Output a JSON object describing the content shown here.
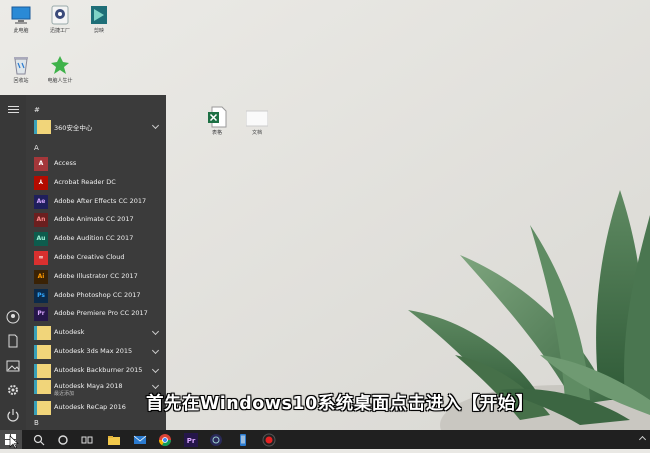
{
  "desktop": {
    "icons": [
      {
        "label": "此电脑",
        "icon": "computer-icon"
      },
      {
        "label": "迅捷工厂",
        "icon": "app-icon"
      },
      {
        "label": "剪映",
        "icon": "video-editor-icon"
      },
      {
        "label": "回收站",
        "icon": "recycle-bin-icon"
      },
      {
        "label": "电脑人生计",
        "icon": "app-icon"
      },
      {
        "label": "表格",
        "icon": "excel-file-icon"
      },
      {
        "label": "文档",
        "icon": "blank-file-icon"
      }
    ]
  },
  "start_menu": {
    "sections": [
      {
        "letter": "#"
      },
      {
        "letter": "A"
      }
    ],
    "items": [
      {
        "label": "360安全中心",
        "icon": "folder-icon",
        "expandable": true
      },
      {
        "label": "Access",
        "icon": "access-icon",
        "color": "#a4373a"
      },
      {
        "label": "Acrobat Reader DC",
        "icon": "acrobat-icon",
        "color": "#b30b00"
      },
      {
        "label": "Adobe After Effects CC 2017",
        "icon": "after-effects-icon",
        "tile": "Ae",
        "color": "#1f1f5c"
      },
      {
        "label": "Adobe Animate CC 2017",
        "icon": "animate-icon",
        "tile": "An",
        "color": "#6b1f1f"
      },
      {
        "label": "Adobe Audition CC 2017",
        "icon": "audition-icon",
        "tile": "Au",
        "color": "#0d5c4d"
      },
      {
        "label": "Adobe Creative Cloud",
        "icon": "creative-cloud-icon",
        "color": "#d9302f"
      },
      {
        "label": "Adobe Illustrator CC 2017",
        "icon": "illustrator-icon",
        "tile": "Ai",
        "color": "#3a2205"
      },
      {
        "label": "Adobe Photoshop CC 2017",
        "icon": "photoshop-icon",
        "tile": "Ps",
        "color": "#0b2a4a"
      },
      {
        "label": "Adobe Premiere Pro CC 2017",
        "icon": "premiere-icon",
        "tile": "Pr",
        "color": "#25164a"
      },
      {
        "label": "Autodesk",
        "icon": "folder-icon",
        "expandable": true
      },
      {
        "label": "Autodesk 3ds Max 2015",
        "icon": "folder-icon",
        "expandable": true
      },
      {
        "label": "Autodesk Backburner 2015",
        "icon": "folder-icon",
        "expandable": true
      },
      {
        "label": "Autodesk Maya 2018",
        "sub": "最近添加",
        "icon": "folder-icon",
        "expandable": true
      },
      {
        "label": "Autodesk ReCap 2016",
        "icon": "folder-icon",
        "expandable": false
      }
    ],
    "bottom_section_letter": "B"
  },
  "subtitle": "首先在Windows10系统桌面点击进入【开始】",
  "taskbar": {
    "items": [
      "search-icon",
      "cortana-icon",
      "task-view-icon",
      "file-explorer-icon",
      "mail-icon",
      "chrome-icon",
      "premiere-icon",
      "after-effects-icon",
      "obs-icon",
      "phone-icon",
      "record-icon"
    ]
  }
}
